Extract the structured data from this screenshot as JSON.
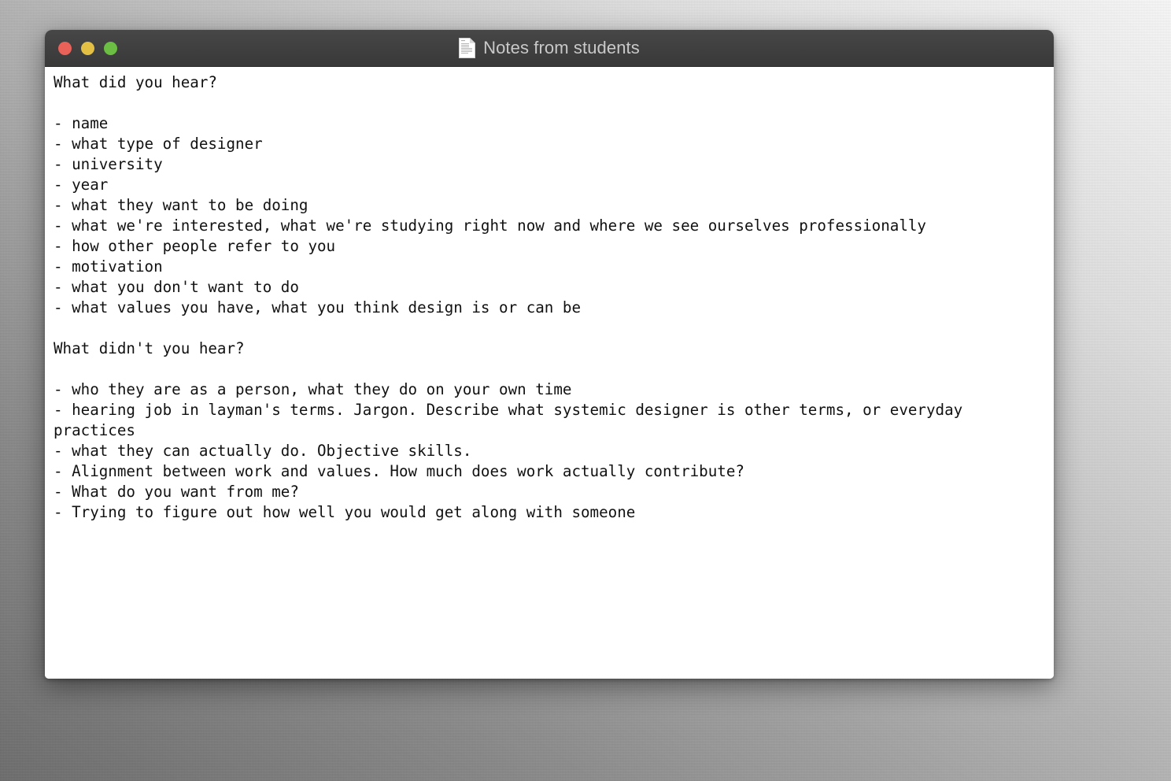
{
  "desktop": {
    "background_top_color": "#fbfbfb",
    "background_bottom_color": "#6f6f6f"
  },
  "window": {
    "title": "Notes from students",
    "icon": "document-icon",
    "controls": {
      "close_label": "",
      "minimize_label": "",
      "zoom_label": "",
      "close_color": "#e8625a",
      "minimize_color": "#e3c044",
      "zoom_color": "#6bbe43"
    },
    "document": {
      "text": "What did you hear?\n\n- name\n- what type of designer\n- university\n- year\n- what they want to be doing\n- what we're interested, what we're studying right now and where we see ourselves professionally\n- how other people refer to you\n- motivation\n- what you don't want to do\n- what values you have, what you think design is or can be\n\nWhat didn't you hear?\n\n- who they are as a person, what they do on your own time\n- hearing job in layman's terms. Jargon. Describe what systemic designer is other terms, or everyday practices\n- what they can actually do. Objective skills.\n- Alignment between work and values. How much does work actually contribute?\n- What do you want from me?\n- Trying to figure out how well you would get along with someone"
    }
  }
}
